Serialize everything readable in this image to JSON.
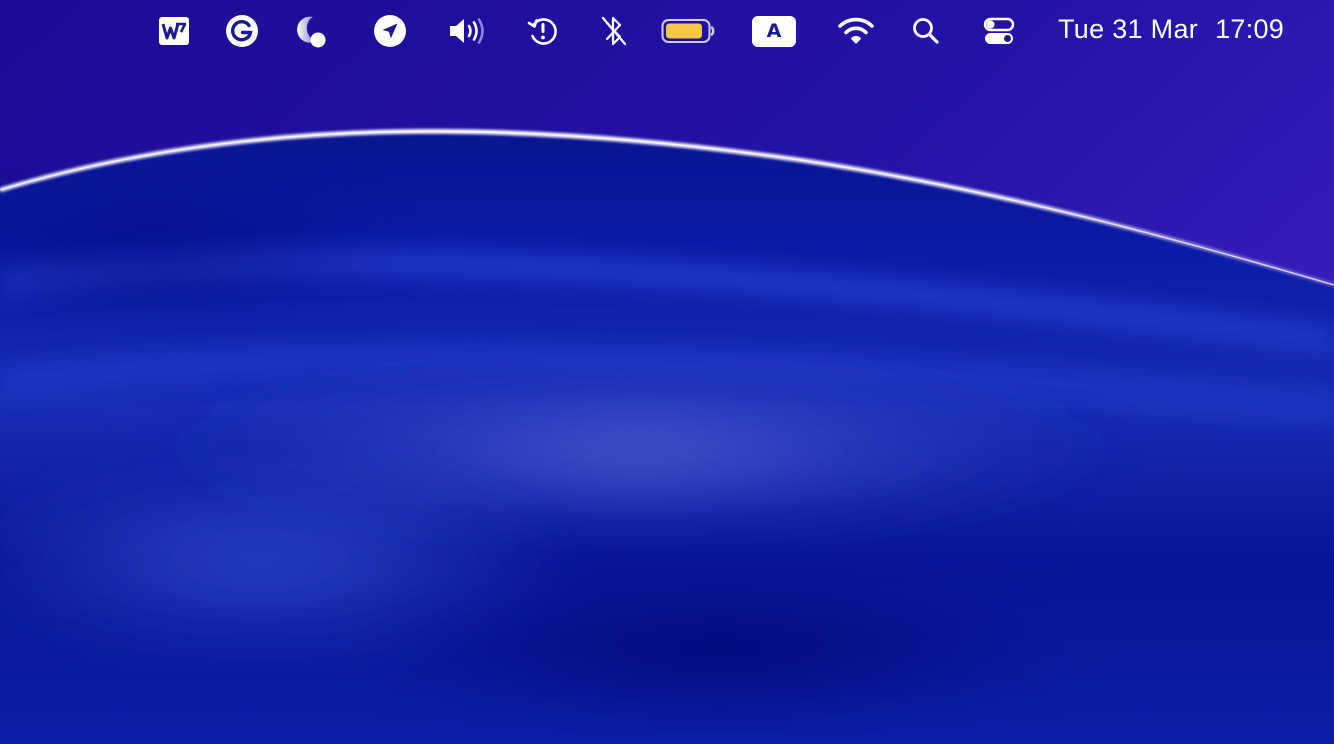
{
  "desktop": {
    "wallpaper": "blue-wave",
    "colors": {
      "top_purple": "#2a12a8",
      "deep_blue": "#0a12a0",
      "highlight_blue": "#4a5ad0",
      "glow_line": "#e8e4f4",
      "battery_fill": "#f6c843"
    }
  },
  "menubar": {
    "status_items": [
      {
        "name": "wps-office",
        "icon": "wps-icon"
      },
      {
        "name": "grammarly",
        "icon": "grammarly-icon"
      },
      {
        "name": "night-shift",
        "icon": "moon-dot-icon"
      },
      {
        "name": "location",
        "icon": "location-arrow-icon"
      },
      {
        "name": "volume",
        "icon": "speaker-icon"
      },
      {
        "name": "time-machine",
        "icon": "time-machine-alert-icon"
      },
      {
        "name": "bluetooth",
        "icon": "bluetooth-off-icon"
      },
      {
        "name": "battery",
        "icon": "battery-icon",
        "level": 0.9
      },
      {
        "name": "input-source",
        "icon": "input-source-icon"
      },
      {
        "name": "wifi",
        "icon": "wifi-icon"
      },
      {
        "name": "spotlight",
        "icon": "search-icon"
      },
      {
        "name": "control-center",
        "icon": "control-center-icon"
      }
    ],
    "input_source_letter": "A",
    "clock": {
      "date": "Tue 31 Mar",
      "time": "17:09"
    }
  }
}
